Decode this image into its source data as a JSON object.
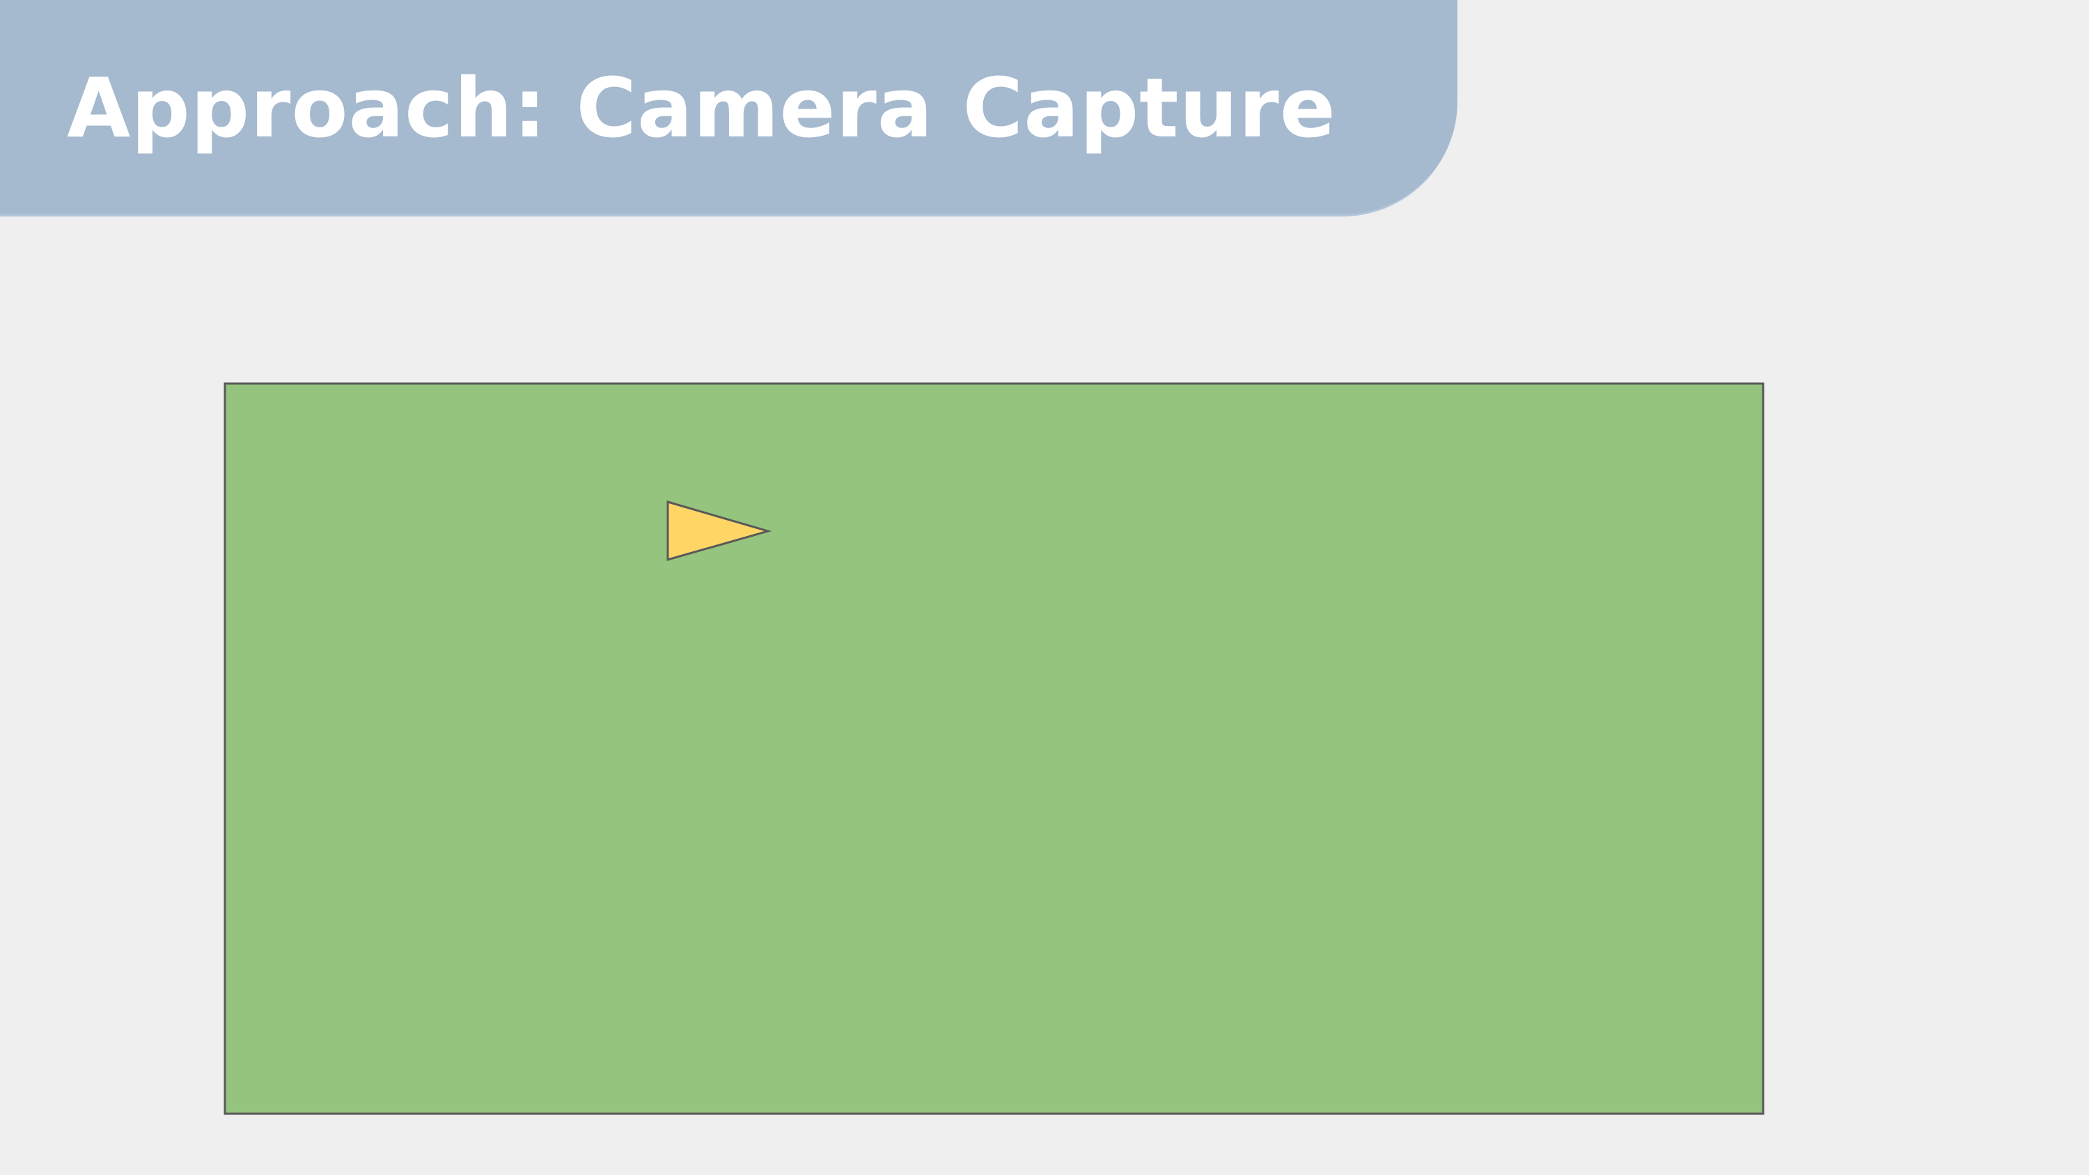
{
  "slide": {
    "title": "Approach: Camera Capture"
  },
  "colors": {
    "background": "#efefef",
    "banner": "#a5b9cf",
    "field": "#94c47d",
    "camera_marker": "#ffd666",
    "stroke": "#595959"
  },
  "diagram": {
    "field": {
      "shape": "rectangle"
    },
    "camera_marker": {
      "shape": "triangle",
      "direction": "right"
    }
  }
}
